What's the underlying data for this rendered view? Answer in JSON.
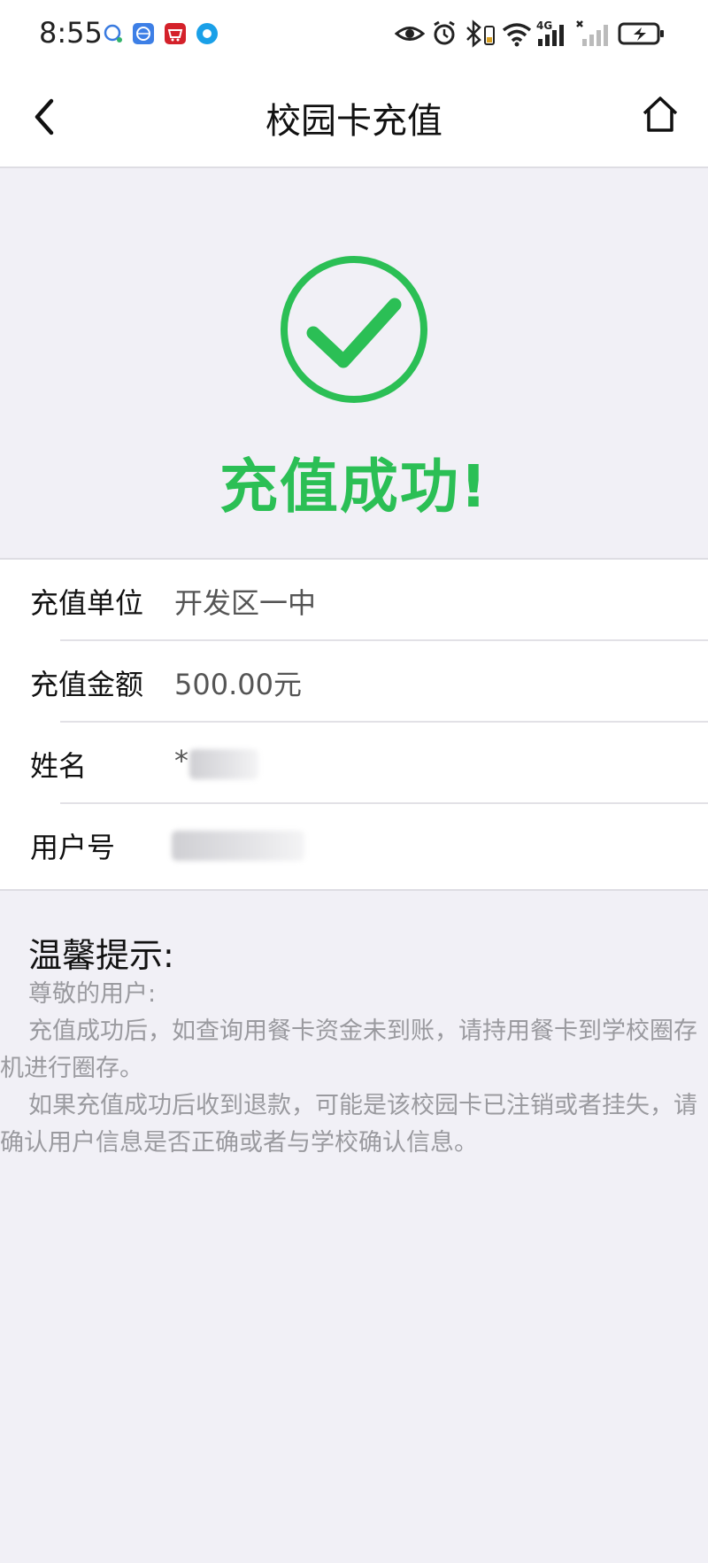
{
  "status_bar": {
    "time": "8:55",
    "icons": [
      "chat-icon",
      "browser-icon",
      "shop-icon",
      "app-icon",
      "eye-icon",
      "alarm-icon",
      "bluetooth-icon",
      "wifi-icon",
      "signal-4g-icon",
      "signal-icon",
      "battery-icon"
    ],
    "network_label": "4G"
  },
  "header": {
    "title": "校园卡充值",
    "back_icon": "chevron-left-icon",
    "home_icon": "home-icon"
  },
  "result": {
    "icon": "check-circle-icon",
    "message": "充值成功!",
    "accent_color": "#2bbf55"
  },
  "details": [
    {
      "label": "充值单位",
      "value": "开发区一中"
    },
    {
      "label": "充值金额",
      "value": "500.00元"
    },
    {
      "label": "姓名",
      "value": "*"
    },
    {
      "label": "用户号",
      "value": ""
    }
  ],
  "tips": {
    "title": "温馨提示:",
    "greeting": "尊敬的用户:",
    "paragraph1": "充值成功后，如查询用餐卡资金未到账，请持用餐卡到学校圈存机进行圈存。",
    "paragraph2": "如果充值成功后收到退款，可能是该校园卡已注销或者挂失，请确认用户信息是否正确或者与学校确认信息。"
  }
}
